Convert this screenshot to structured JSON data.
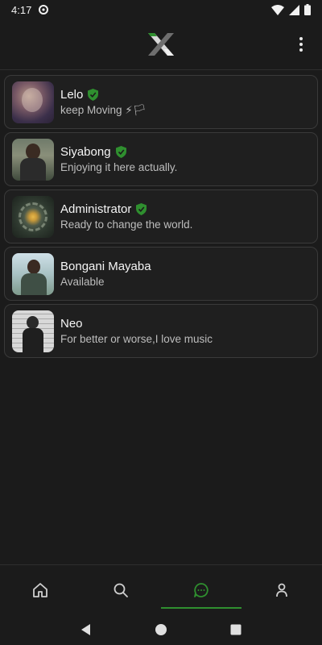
{
  "status_bar": {
    "time": "4:17"
  },
  "colors": {
    "accent": "#2f8f2f",
    "background": "#1b1b1b",
    "card_border": "#3a3a3a"
  },
  "contacts": [
    {
      "name": "Lelo",
      "status": "keep Moving ⚡🏳",
      "verified": true
    },
    {
      "name": "Siyabong",
      "status": "Enjoying it here actually.",
      "verified": true
    },
    {
      "name": "Administrator",
      "status": "Ready to change the world.",
      "verified": true
    },
    {
      "name": "Bongani Mayaba",
      "status": "Available",
      "verified": false
    },
    {
      "name": "Neo",
      "status": "For better or worse,I love music",
      "verified": false
    }
  ],
  "bottom_nav": {
    "active": "chats",
    "items": [
      {
        "id": "home",
        "icon": "home-icon"
      },
      {
        "id": "search",
        "icon": "search-icon"
      },
      {
        "id": "chats",
        "icon": "chat-icon"
      },
      {
        "id": "profile",
        "icon": "person-icon"
      }
    ]
  }
}
